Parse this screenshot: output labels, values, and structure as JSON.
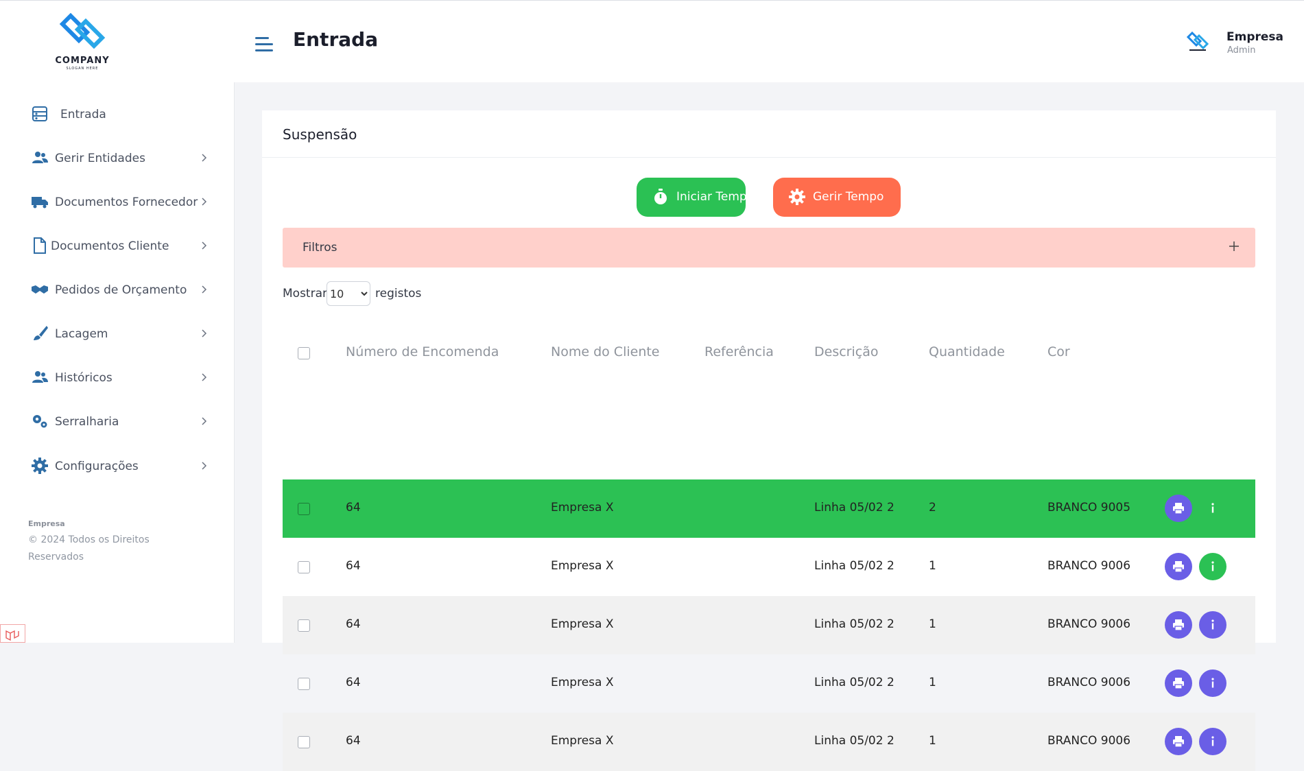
{
  "header": {
    "logo_text": "COMPANY",
    "logo_slogan": "SLOGAN HERE",
    "title": "Entrada",
    "user_name": "Empresa",
    "user_role": "Admin"
  },
  "sidebar": {
    "items": [
      {
        "label": "Entrada",
        "icon": "dashboard-icon",
        "has_chevron": false
      },
      {
        "label": "Gerir Entidades",
        "icon": "users-icon",
        "has_chevron": true
      },
      {
        "label": "Documentos Fornecedor",
        "icon": "truck-icon",
        "has_chevron": true
      },
      {
        "label": "Documentos Cliente",
        "icon": "file-icon",
        "has_chevron": true
      },
      {
        "label": "Pedidos de Orçamento",
        "icon": "handshake-icon",
        "has_chevron": true
      },
      {
        "label": "Lacagem",
        "icon": "brush-icon",
        "has_chevron": true
      },
      {
        "label": "Históricos",
        "icon": "users-icon",
        "has_chevron": true
      },
      {
        "label": "Serralharia",
        "icon": "gears-icon",
        "has_chevron": true
      },
      {
        "label": "Configurações",
        "icon": "gear-icon",
        "has_chevron": true
      }
    ],
    "footer_brand": "Empresa",
    "footer_copy": "© 2024 Todos os Direitos Reservados"
  },
  "card": {
    "title": "Suspensão",
    "start_button": "Iniciar Tempo",
    "manage_button": "Gerir Tempo",
    "filters_label": "Filtros",
    "show_label": "Mostrar",
    "show_value": "10",
    "records_label": "registos"
  },
  "colors": {
    "accent_green": "#2bc154",
    "accent_orange": "#ff6d4d",
    "accent_purple": "#6a5ee6",
    "filter_bg": "#ffd0cb"
  },
  "table": {
    "headers": [
      "Número de Encomenda",
      "Nome do Cliente",
      "Referência",
      "Descrição",
      "Quantidade",
      "Cor"
    ],
    "rows": [
      {
        "order": "64",
        "client": "Empresa X",
        "reference": "",
        "description": "Linha 05/02 2",
        "quantity": "2",
        "color": "BRANCO 9005",
        "state": "highlight"
      },
      {
        "order": "64",
        "client": "Empresa X",
        "reference": "",
        "description": "Linha 05/02 2",
        "quantity": "1",
        "color": "BRANCO 9006",
        "state": "normal"
      },
      {
        "order": "64",
        "client": "Empresa X",
        "reference": "",
        "description": "Linha 05/02 2",
        "quantity": "1",
        "color": "BRANCO 9006",
        "state": "striped"
      },
      {
        "order": "64",
        "client": "Empresa X",
        "reference": "",
        "description": "Linha 05/02 2",
        "quantity": "1",
        "color": "BRANCO 9006",
        "state": "normal"
      },
      {
        "order": "64",
        "client": "Empresa X",
        "reference": "",
        "description": "Linha 05/02 2",
        "quantity": "1",
        "color": "BRANCO 9006",
        "state": "striped"
      }
    ]
  }
}
